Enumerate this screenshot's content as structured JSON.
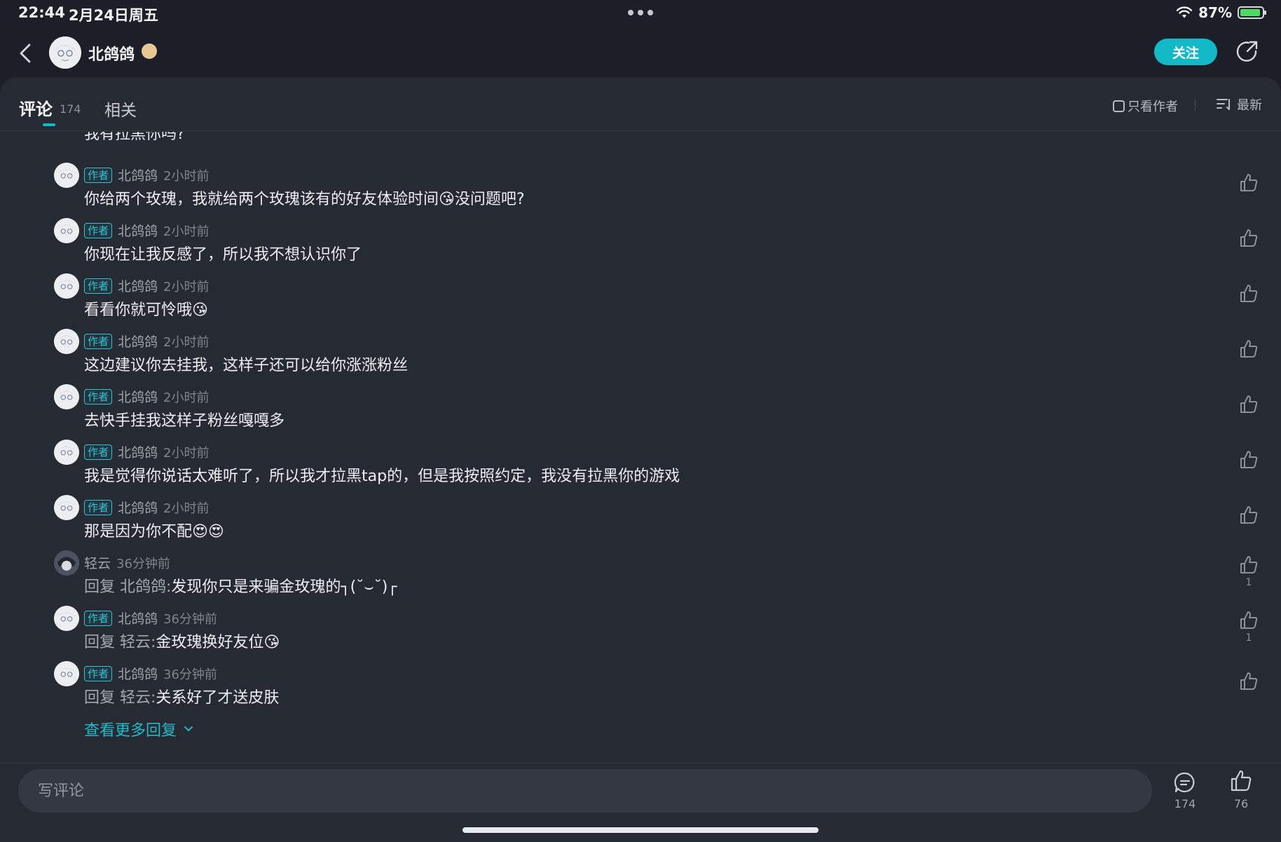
{
  "status_bar": {
    "time": "22:44",
    "date": "2月24日周五",
    "battery": "87%"
  },
  "header": {
    "user_name": "北鸽鸽",
    "follow_label": "关注"
  },
  "tabs": {
    "comments_label": "评论",
    "comments_count": "174",
    "related_label": "相关",
    "only_author_label": "只看作者",
    "sort_label": "最新"
  },
  "partial_comment": {
    "text": "我有拉黑你吗?"
  },
  "comments": [
    {
      "author_tag": "作者",
      "name": "北鸽鸽",
      "time": "2小时前",
      "text": "你给两个玫瑰，我就给两个玫瑰该有的好友体验时间😘没问题吧?"
    },
    {
      "author_tag": "作者",
      "name": "北鸽鸽",
      "time": "2小时前",
      "text": "你现在让我反感了，所以我不想认识你了"
    },
    {
      "author_tag": "作者",
      "name": "北鸽鸽",
      "time": "2小时前",
      "text": "看看你就可怜哦😘"
    },
    {
      "author_tag": "作者",
      "name": "北鸽鸽",
      "time": "2小时前",
      "text": "这边建议你去挂我，这样子还可以给你涨涨粉丝"
    },
    {
      "author_tag": "作者",
      "name": "北鸽鸽",
      "time": "2小时前",
      "text": "去快手挂我这样子粉丝嘎嘎多"
    },
    {
      "author_tag": "作者",
      "name": "北鸽鸽",
      "time": "2小时前",
      "text": "我是觉得你说话太难听了，所以我才拉黑tap的，但是我按照约定，我没有拉黑你的游戏"
    },
    {
      "author_tag": "作者",
      "name": "北鸽鸽",
      "time": "2小时前",
      "text": "那是因为你不配😍😍"
    },
    {
      "author_tag": "",
      "name": "轻云",
      "time": "36分钟前",
      "reply_prefix": "回复 北鸽鸽:",
      "text": "发现你只是来骗金玫瑰的┐(˘⌣˘)┌",
      "likes": "1"
    },
    {
      "author_tag": "作者",
      "name": "北鸽鸽",
      "time": "36分钟前",
      "reply_prefix": "回复 轻云:",
      "text": "金玫瑰换好友位😘",
      "likes": "1"
    },
    {
      "author_tag": "作者",
      "name": "北鸽鸽",
      "time": "36分钟前",
      "reply_prefix": "回复 轻云:",
      "text": "关系好了才送皮肤"
    }
  ],
  "more_replies_label": "查看更多回复",
  "bottom_bar": {
    "placeholder": "写评论",
    "comment_count": "174",
    "like_count": "76"
  },
  "icons": {
    "back": "back-arrow-icon",
    "share": "share-icon",
    "like": "thumbs-up-icon",
    "comment": "comment-bubble-icon",
    "sort": "sort-list-icon",
    "wifi": "wifi-icon"
  },
  "colors": {
    "accent": "#14b9c8",
    "background": "#1c1f27",
    "panel": "#262a33"
  }
}
